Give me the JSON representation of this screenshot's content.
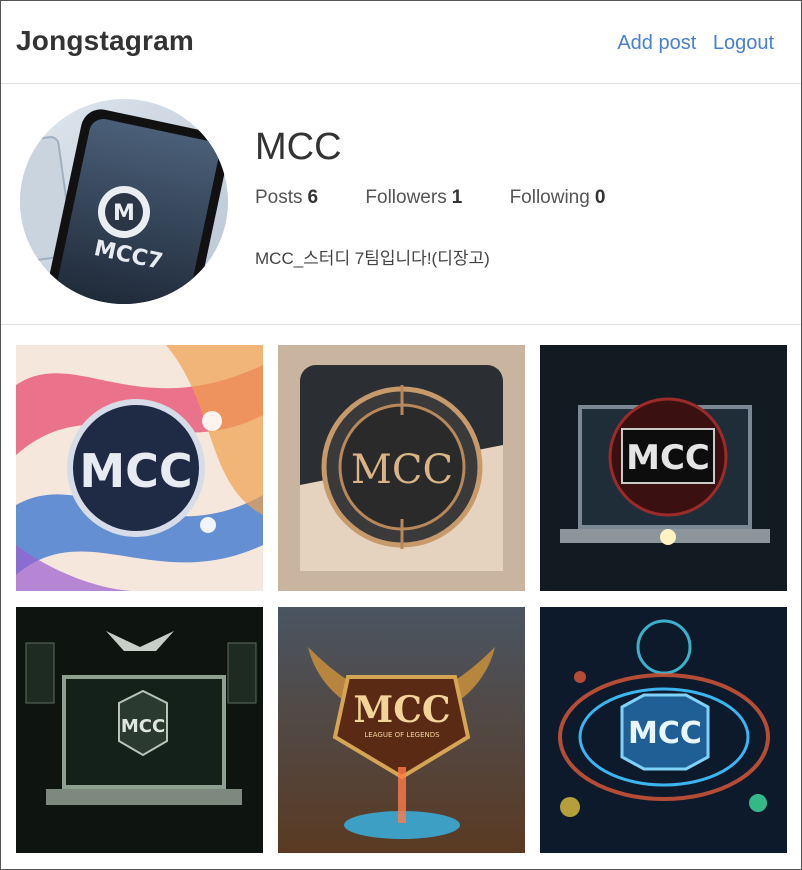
{
  "header": {
    "brand": "Jongstagram",
    "add_post": "Add post",
    "logout": "Logout"
  },
  "profile": {
    "username": "MCC",
    "avatar_text": "MCC7",
    "stats": [
      {
        "label": "Posts",
        "value": "6"
      },
      {
        "label": "Followers",
        "value": "1"
      },
      {
        "label": "Following",
        "value": "0"
      }
    ],
    "bio": "MCC_스터디 7팀입니다!(디장고)"
  },
  "posts": [
    {
      "text": "MCC"
    },
    {
      "text": "MCC"
    },
    {
      "text": "MCC"
    },
    {
      "text": "MCC"
    },
    {
      "text": "MCC",
      "subtext": "LEAGUE OF LEGENDS"
    },
    {
      "text": "MCC"
    }
  ],
  "colors": {
    "link": "#4a7fd0",
    "border": "#dddddd",
    "text": "#333333"
  }
}
